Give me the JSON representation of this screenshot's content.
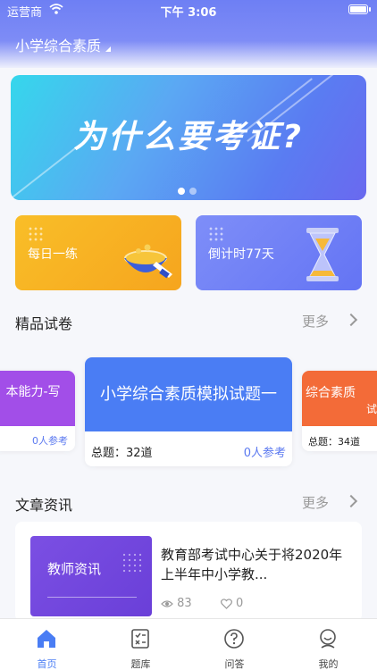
{
  "status": {
    "carrier": "运营商",
    "time": "下午 3:06"
  },
  "header": {
    "subject": "小学综合素质"
  },
  "banner": {
    "title": "为什么要考证?"
  },
  "cards": {
    "daily": "每日一练",
    "countdown": "倒计时77天"
  },
  "papers": {
    "title": "精品试卷",
    "more": "更多",
    "left": {
      "title": "本能力-写",
      "participants": "0人参考"
    },
    "center": {
      "title": "小学综合素质模拟试题一",
      "questions": "总题：32道",
      "participants": "0人参考"
    },
    "right": {
      "title_line1": "综合素质",
      "title_line2": "试",
      "questions": "总题：34道"
    }
  },
  "articles": {
    "title": "文章资讯",
    "more": "更多",
    "item": {
      "thumb_label": "教师资讯",
      "title": "教育部考试中心关于将2020年上半年中小学教...",
      "views": "83",
      "likes": "0"
    }
  },
  "tabs": [
    {
      "label": "首页"
    },
    {
      "label": "题库"
    },
    {
      "label": "问答"
    },
    {
      "label": "我的"
    }
  ],
  "colors": {
    "accent": "#4a7df4",
    "header": "#6e7ff4",
    "daily": "#f9be28",
    "countdown": "#7080f6"
  }
}
